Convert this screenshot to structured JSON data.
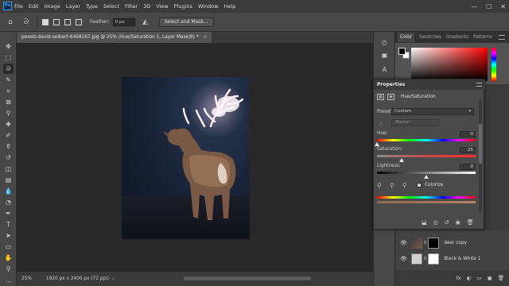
{
  "app": {
    "logo_text": "Ps"
  },
  "menubar": {
    "items": [
      "File",
      "Edit",
      "Image",
      "Layer",
      "Type",
      "Select",
      "Filter",
      "3D",
      "View",
      "Plugins",
      "Window",
      "Help"
    ],
    "window_controls": [
      "—",
      "☐",
      "✕"
    ]
  },
  "options_bar": {
    "feather_label": "Feather:",
    "feather_value": "0 px",
    "select_mask_label": "Select and Mask..."
  },
  "document": {
    "tab_title": "pexels-david-selbert-6468167.jpg @ 25% (Hue/Saturation 1, Layer Mask/8) *",
    "close_glyph": "×"
  },
  "status_bar": {
    "zoom": "25%",
    "dimensions": "1920 px x 2400 px (72 ppi)",
    "chevron": "›"
  },
  "color_panel": {
    "tabs": [
      "Color",
      "Swatches",
      "Gradients",
      "Patterns"
    ],
    "active_tab": "Color",
    "foreground": "#000000",
    "background": "#ffffff"
  },
  "properties": {
    "title": "Properties",
    "adjustment_name": "Hue/Saturation",
    "preset_label": "Preset:",
    "preset_value": "Custom",
    "channel_value": "Master",
    "hue": {
      "label": "Hue:",
      "value": "0",
      "position": 0.0
    },
    "saturation": {
      "label": "Saturation:",
      "value": "25",
      "position": 0.25
    },
    "lightness": {
      "label": "Lightness:",
      "value": "0",
      "position": 0.5
    },
    "colorize_label": "Colorize",
    "colorize_checked": true
  },
  "layers": [
    {
      "name": "deer copy",
      "visible": true
    },
    {
      "name": "Black & White 1",
      "visible": true
    }
  ],
  "icons": {
    "eye": "👁",
    "link": "8",
    "footer": [
      "fx",
      "◐",
      "▭",
      "▣",
      "🗑"
    ]
  },
  "colors": {
    "accent": "#31a8ff",
    "panel_bg": "#3c3c3c",
    "canvas_bg": "#282828"
  }
}
